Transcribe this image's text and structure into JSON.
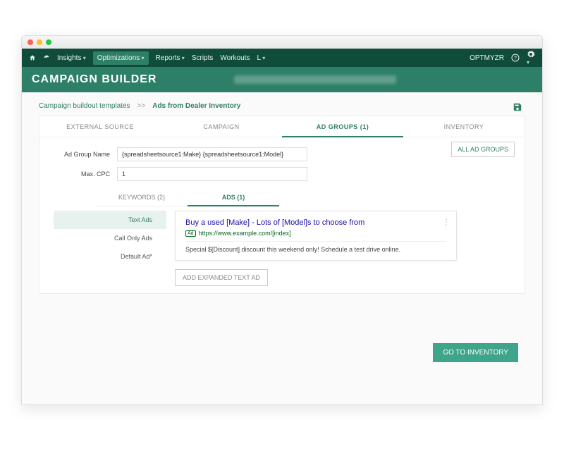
{
  "nav": {
    "insights": "Insights",
    "optimizations": "Optimizations",
    "reports": "Reports",
    "scripts": "Scripts",
    "workouts": "Workouts",
    "accountMenu": "L",
    "brand": "OPTMYZR"
  },
  "header": {
    "title": "CAMPAIGN BUILDER"
  },
  "breadcrumb": {
    "root": "Campaign buildout templates",
    "sep": ">>",
    "current": "Ads from Dealer Inventory"
  },
  "tabs": {
    "external": "EXTERNAL SOURCE",
    "campaign": "CAMPAIGN",
    "adgroups": "AD GROUPS (1)",
    "inventory": "INVENTORY"
  },
  "buttons": {
    "allAdGroups": "ALL AD GROUPS",
    "addExpanded": "ADD EXPANDED TEXT AD",
    "goToInventory": "GO TO INVENTORY"
  },
  "form": {
    "adGroupNameLabel": "Ad Group Name",
    "adGroupNameValue": "{spreadsheetsource1:Make} {spreadsheetsource1:Model}",
    "maxCpcLabel": "Max. CPC",
    "maxCpcValue": "1"
  },
  "subtabs": {
    "keywords": "KEYWORDS (2)",
    "ads": "ADS (1)"
  },
  "adTypes": {
    "text": "Text Ads",
    "callOnly": "Call Only Ads",
    "default": "Default Ad*"
  },
  "adPreview": {
    "headline": "Buy a used [Make] - Lots of [Model]s to choose from",
    "adLabel": "Ad",
    "url": "https://www.example.com/[index]",
    "description": "Special $[Discount] discount this weekend only! Schedule a test drive online."
  }
}
